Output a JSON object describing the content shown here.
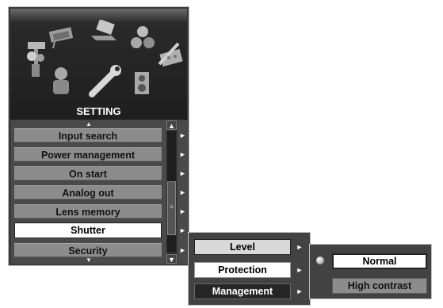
{
  "panel": {
    "title": "SETTING",
    "scroll_up": "▲",
    "scroll_down": "▼",
    "items": [
      {
        "label": "Input search"
      },
      {
        "label": "Power management"
      },
      {
        "label": "On start"
      },
      {
        "label": "Analog out"
      },
      {
        "label": "Lens memory"
      },
      {
        "label": "Shutter"
      },
      {
        "label": "Security"
      }
    ],
    "selected_item": "Shutter",
    "arrow": "►",
    "scrollbar": {
      "up": "▲",
      "down": "▼",
      "grip": "≡"
    }
  },
  "submenu": {
    "items": [
      {
        "label": "Level"
      },
      {
        "label": "Protection"
      },
      {
        "label": "Management"
      }
    ],
    "arrow": "►"
  },
  "submenu2": {
    "options": [
      {
        "label": "Normal"
      },
      {
        "label": "High contrast"
      }
    ],
    "selected": "Normal"
  },
  "colors": {
    "panel_bg": "#3a3a3a",
    "item_bg": "#8c8c8c",
    "selected_bg": "#ffffff"
  }
}
